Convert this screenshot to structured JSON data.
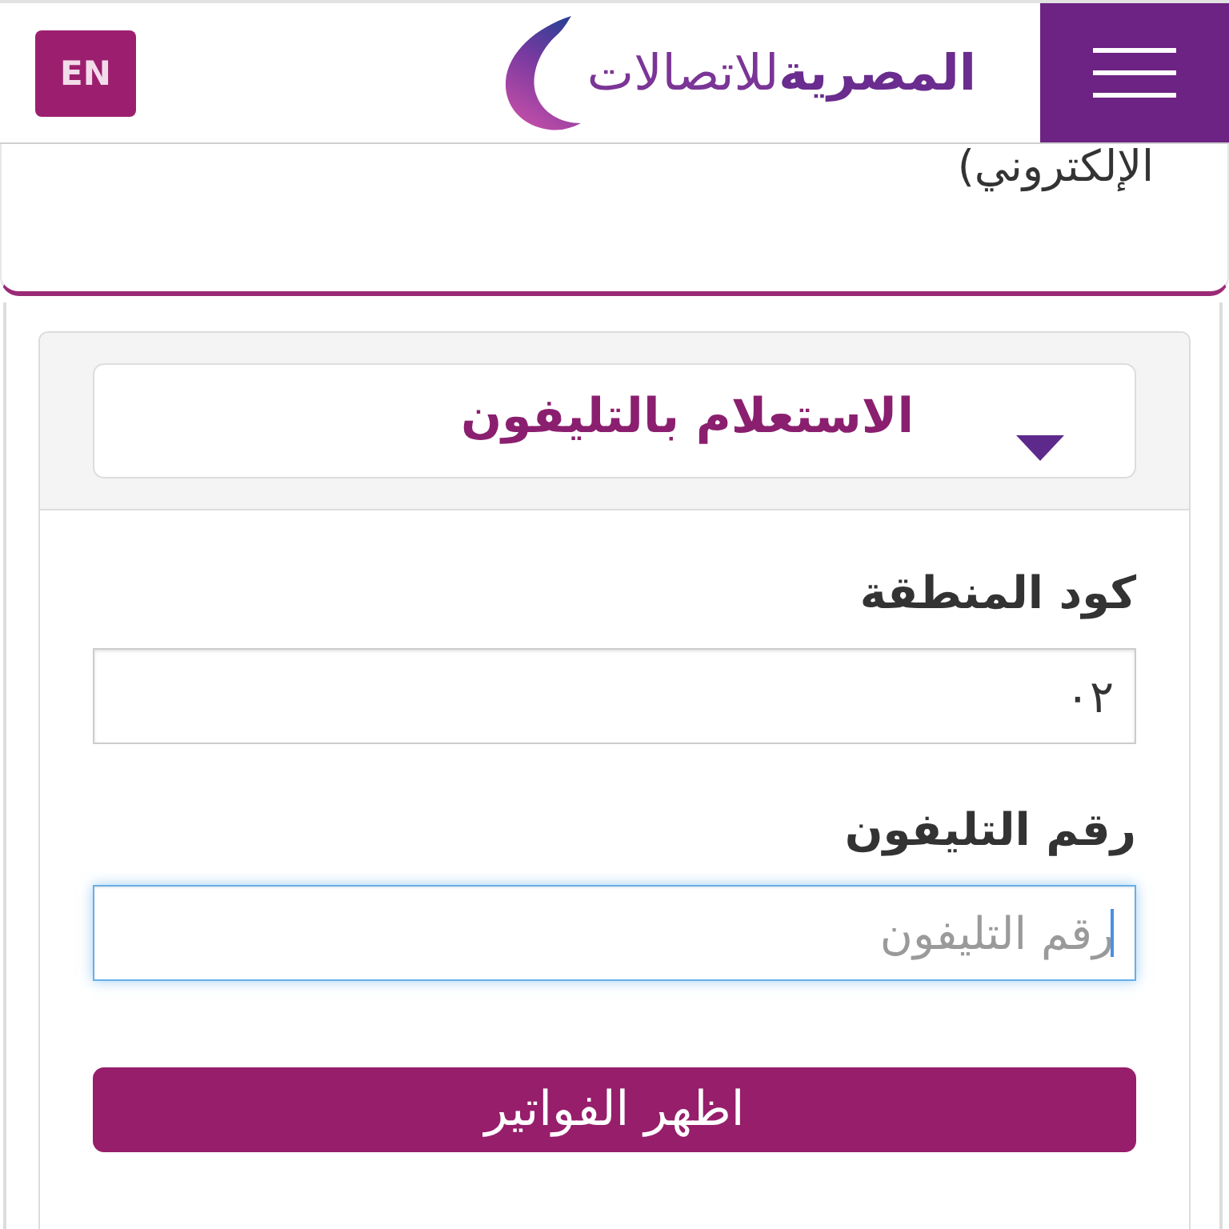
{
  "header": {
    "language_button": "EN",
    "logo_text": "**المصرية**للاتصالات"
  },
  "intro": {
    "text": "الإلكتروني)"
  },
  "panel": {
    "dropdown": "الاستعلام بالتليفون",
    "fields": [
      {
        "label": "كود المنطقة",
        "value": "٠٢",
        "focused": false
      },
      {
        "label": "رقم التليفون",
        "placeholder": "رقم التليفون",
        "focused": true
      }
    ],
    "submit_button": "اظهر الفواتير"
  }
}
